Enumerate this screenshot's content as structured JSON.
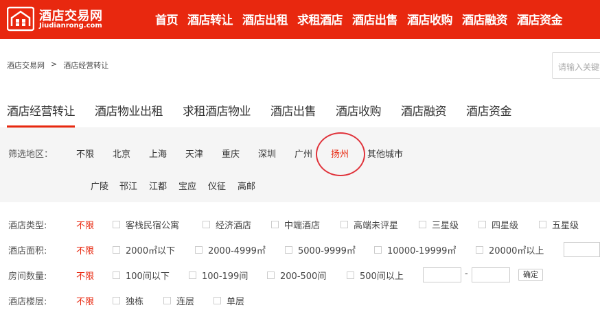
{
  "brand": {
    "name": "酒店交易网",
    "domain": "Jiudianrong.com",
    "color": "#e8280f"
  },
  "nav": [
    "首页",
    "酒店转让",
    "酒店出租",
    "求租酒店",
    "酒店出售",
    "酒店收购",
    "酒店融资",
    "酒店资金"
  ],
  "breadcrumb": {
    "home": "酒店交易网",
    "separator": ">",
    "current": "酒店经营转让"
  },
  "search": {
    "placeholder": "请输入关键字"
  },
  "tabs": [
    "酒店经营转让",
    "酒店物业出租",
    "求租酒店物业",
    "酒店出售",
    "酒店收购",
    "酒店融资",
    "酒店资金"
  ],
  "active_tab": "酒店经营转让",
  "region": {
    "label": "筛选地区：",
    "items": [
      "不限",
      "北京",
      "上海",
      "天津",
      "重庆",
      "深圳",
      "广州",
      "扬州",
      "其他城市"
    ],
    "selected": "扬州",
    "sub_items": [
      "广陵",
      "邗江",
      "江都",
      "宝应",
      "仪征",
      "高邮"
    ]
  },
  "filters": {
    "type": {
      "label": "酒店类型:",
      "any": "不限",
      "options": [
        "客栈民宿公寓",
        "经济酒店",
        "中端酒店",
        "高端未评星",
        "三星级",
        "四星级",
        "五星级"
      ]
    },
    "area": {
      "label": "酒店面积:",
      "any": "不限",
      "options": [
        "2000㎡以下",
        "2000-4999㎡",
        "5000-9999㎡",
        "10000-19999㎡",
        "20000㎡以上"
      ]
    },
    "rooms": {
      "label": "房间数量:",
      "any": "不限",
      "options": [
        "100间以下",
        "100-199间",
        "200-500间",
        "500间以上"
      ],
      "range_separator": "-",
      "confirm": "确定"
    },
    "floors": {
      "label": "酒店楼层:",
      "any": "不限",
      "options": [
        "独栋",
        "连层",
        "单层"
      ]
    }
  }
}
